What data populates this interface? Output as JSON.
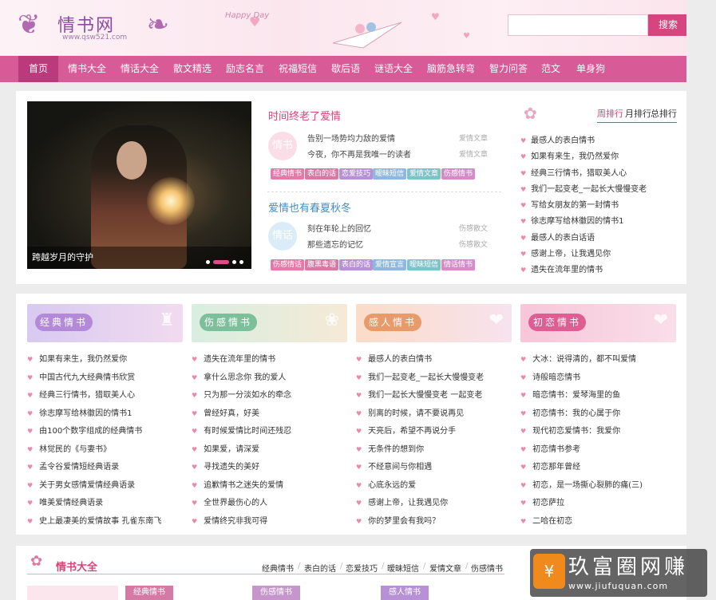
{
  "header": {
    "logo_name": "情书网",
    "logo_url": "www.qsw521.com",
    "deco_text": "Happy Day",
    "search_placeholder": "",
    "search_button": "搜索"
  },
  "nav": {
    "items": [
      "首页",
      "情书大全",
      "情话大全",
      "散文精选",
      "励志名言",
      "祝福短信",
      "歇后语",
      "谜语大全",
      "脑筋急转弯",
      "智力问答",
      "范文",
      "单身狗"
    ],
    "active": 0
  },
  "slider": {
    "caption": "跨越岁月的守护"
  },
  "featured": [
    {
      "title": "时间终老了爱情",
      "badge": "情书",
      "lines": [
        {
          "text": "告别一场势均力敌的爱情",
          "cat": "爱情文章"
        },
        {
          "text": "今夜，你不再是我唯一的读者",
          "cat": "爱情文章"
        }
      ],
      "tags": [
        "经典情书",
        "表白的话",
        "恋爱技巧",
        "暧昧短信",
        "爱情文章",
        "伤感情书"
      ]
    },
    {
      "title": "爱情也有春夏秋冬",
      "badge": "情话",
      "lines": [
        {
          "text": "刻在年轮上的回忆",
          "cat": "伤感散文"
        },
        {
          "text": "那些遗忘的记忆",
          "cat": "伤感散文"
        }
      ],
      "tags": [
        "伤感情话",
        "腹黑毒语",
        "表白的话",
        "爱情宣言",
        "暧昧短信",
        "情话情书"
      ]
    }
  ],
  "ranking": {
    "tabs": [
      "周排行",
      "月排行",
      "总排行"
    ],
    "active": 0,
    "items": [
      "最感人的表白情书",
      "如果有来生，我仍然爱你",
      "经典三行情书，猎取美人心",
      "我们一起变老_一起长大慢慢变老",
      "写给女朋友的第一封情书",
      "徐志摩写给林徽因的情书1",
      "最感人的表白话语",
      "感谢上帝，让我遇见你",
      "遗失在流年里的情书"
    ]
  },
  "columns": [
    {
      "title": "经典情书",
      "items": [
        "如果有来生，我仍然爱你",
        "中国古代九大经典情书欣赏",
        "经典三行情书，猎取美人心",
        "徐志摩写给林徽因的情书1",
        "由100个数字组成的经典情书",
        "林觉民的《与妻书》",
        "孟令谷爱情短经典语录",
        "关于男女感情爱情经典语录",
        "唯美爱情经典语录",
        "史上最凄美的爱情故事 孔雀东南飞"
      ]
    },
    {
      "title": "伤感情书",
      "items": [
        "遗失在流年里的情书",
        "拿什么思念你 我的爱人",
        "只为那一分淡如水的牵念",
        "曾经好真，好美",
        "有时候爱情比时间还残忍",
        "如果爱，请深爱",
        "寻找遗失的美好",
        "追歉情书之迷失的爱情",
        "全世界最伤心的人",
        "爱情终究非我可得"
      ]
    },
    {
      "title": "感人情书",
      "items": [
        "最感人的表白情书",
        "我们一起变老_一起长大慢慢变老",
        "我们一起长大慢慢变老 一起变老",
        "别离的时候，请不要说再见",
        "天亮后，希望不再说分手",
        "无条件的想到你",
        "不经意间与你相遇",
        "心底永远的爱",
        "感谢上帝，让我遇见你",
        "你的梦里会有我吗？"
      ]
    },
    {
      "title": "初恋情书",
      "items": [
        "大冰：说得清的，都不叫爱情",
        "诗般暗恋情书",
        "暗恋情书：爱琴海里的鱼",
        "初恋情书：我的心属于你",
        "现代初恋爱情书：我爱你",
        "初恋情书参考",
        "初恋那年曾经",
        "初恋，是一场撕心裂肺的痛(三)",
        "初恋萨拉",
        "二哈在初恋"
      ]
    }
  ],
  "section": {
    "title": "情书大全",
    "links": [
      "经典情书",
      "表白的话",
      "恋爱技巧",
      "暧昧短信",
      "爱情文章",
      "伤感情书"
    ],
    "subtabs": [
      "经典情书",
      "伤感情书",
      "感人情书"
    ]
  },
  "watermark": {
    "icon": "¥",
    "text": "玖富圈网赚",
    "url": "www.jiufuquan.com"
  },
  "colors": {
    "nav": "#d85a96",
    "accent": "#d8447a",
    "tag_colors": [
      "#e47aa8",
      "#d57aa5",
      "#b790d6",
      "#8fb8e0",
      "#7ec3c9",
      "#d58bc8"
    ]
  }
}
